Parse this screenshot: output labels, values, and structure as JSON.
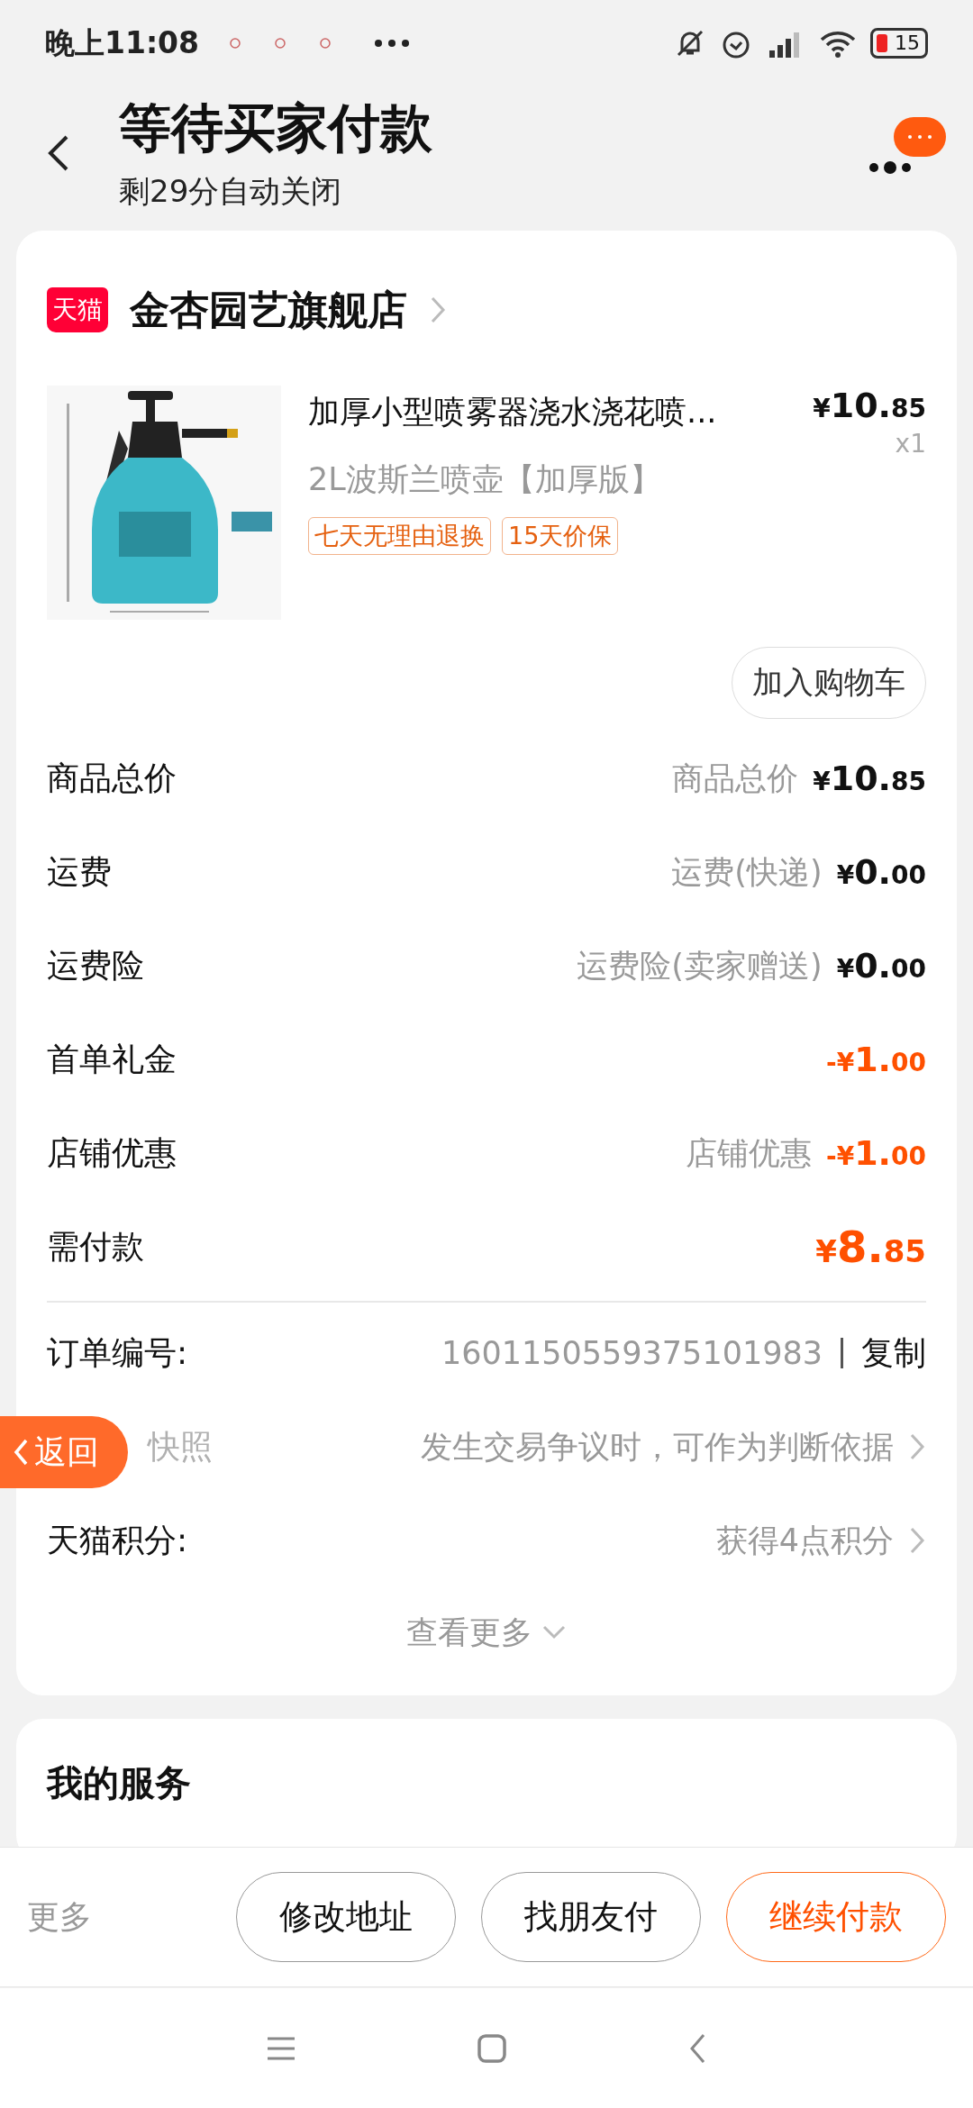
{
  "status_bar": {
    "time": "晚上11:08",
    "battery": "15"
  },
  "header": {
    "title": "等待买家付款",
    "subtitle": "剩29分自动关闭"
  },
  "store": {
    "badge": "天猫",
    "name": "金杏园艺旗舰店"
  },
  "product": {
    "kind": "picture",
    "title": "加厚小型喷雾器浇水浇花喷...",
    "variant": "2L波斯兰喷壶【加厚版】",
    "price": {
      "prefix": "¥",
      "main": "10.",
      "fraction": "85"
    },
    "quantity": "x1",
    "tags": [
      "七天无理由退换",
      "15天价保"
    ],
    "cart_button": "加入购物车"
  },
  "price_rows": [
    {
      "kind": "normal",
      "label": "商品总价",
      "note": "商品总价",
      "amount": {
        "prefix": "¥",
        "main": "10.",
        "fraction": "85"
      }
    },
    {
      "kind": "normal",
      "label": "运费",
      "note": "运费(快递)",
      "amount": {
        "prefix": "¥",
        "main": "0.",
        "fraction": "00"
      }
    },
    {
      "kind": "normal",
      "label": "运费险",
      "note": "运费险(卖家赠送)",
      "amount": {
        "prefix": "¥",
        "main": "0.",
        "fraction": "00"
      }
    },
    {
      "kind": "discount",
      "label": "首单礼金",
      "amount": {
        "prefix": "-¥",
        "main": "1.",
        "fraction": "00"
      }
    },
    {
      "kind": "discount",
      "label": "店铺优惠",
      "note": "店铺优惠",
      "amount": {
        "prefix": "-¥",
        "main": "1.",
        "fraction": "00"
      }
    },
    {
      "kind": "total",
      "label": "需付款",
      "amount": {
        "prefix": "¥",
        "main": "8.",
        "fraction": "85"
      }
    }
  ],
  "info_rows": [
    {
      "kind": "copy",
      "label": "订单编号:",
      "value": "1601150559375101983",
      "action": "复制"
    },
    {
      "kind": "link",
      "label": "快照",
      "value": "发生交易争议时，可作为判断依据"
    },
    {
      "kind": "link",
      "label": "天猫积分:",
      "value": "获得4点积分"
    }
  ],
  "more_link": "查看更多",
  "floating_back": "返回",
  "services": {
    "title": "我的服务"
  },
  "actions": {
    "more": "更多",
    "buttons": [
      {
        "label": "修改地址",
        "primary": false
      },
      {
        "label": "找朋友付",
        "primary": false
      },
      {
        "label": "继续付款",
        "primary": true
      }
    ]
  }
}
